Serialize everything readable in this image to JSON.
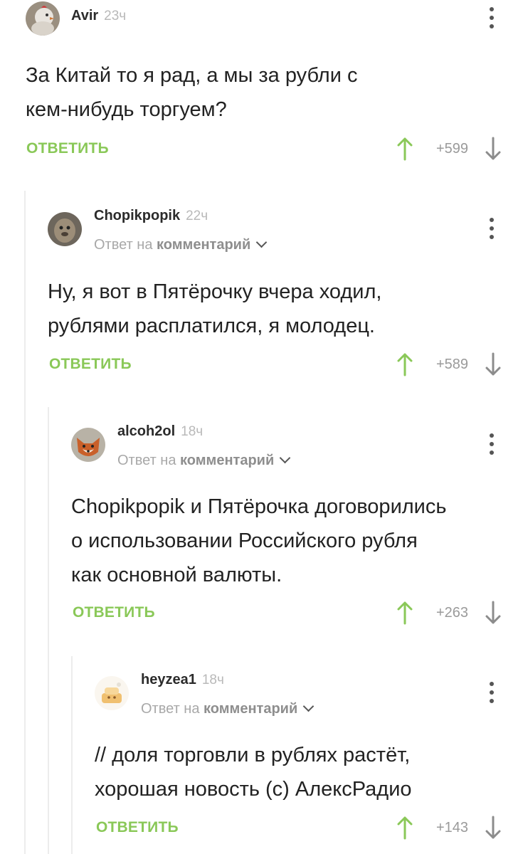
{
  "comments": [
    {
      "username": "Avir",
      "time": "23ч",
      "reply_to": null,
      "text_lines": [
        "За Китай то я рад, а мы за рубли с",
        "кем-нибудь торгуем?"
      ],
      "reply_label": "ОТВЕТИТЬ",
      "rating": "+599"
    },
    {
      "username": "Chopikpopik",
      "time": "22ч",
      "reply_to": {
        "prefix": "Ответ на",
        "target": "комментарий"
      },
      "text_lines": [
        "Ну, я вот в Пятёрочку вчера ходил,",
        "рублями расплатился, я молодец."
      ],
      "reply_label": "ОТВЕТИТЬ",
      "rating": "+589"
    },
    {
      "username": "alcoh2ol",
      "time": "18ч",
      "reply_to": {
        "prefix": "Ответ на",
        "target": "комментарий"
      },
      "text_lines": [
        "Chopikpopik и Пятёрочка договорились",
        "о использовании Российского рубля",
        "как основной валюты."
      ],
      "reply_label": "ОТВЕТИТЬ",
      "rating": "+263"
    },
    {
      "username": "heyzea1",
      "time": "18ч",
      "reply_to": {
        "prefix": "Ответ на",
        "target": "комментарий"
      },
      "text_lines": [
        "// доля торговли в рублях растёт,",
        "хорошая новость (с) АлексРадио"
      ],
      "reply_label": "ОТВЕТИТЬ",
      "rating": "+143"
    }
  ],
  "colors": {
    "reply_green": "#8ac858",
    "thread_line": "#ececec",
    "muted_text": "#a8a8a8"
  },
  "icons": [
    "avatar",
    "more-vertical-icon",
    "chevron-down-icon",
    "arrow-up-icon",
    "arrow-down-icon"
  ]
}
